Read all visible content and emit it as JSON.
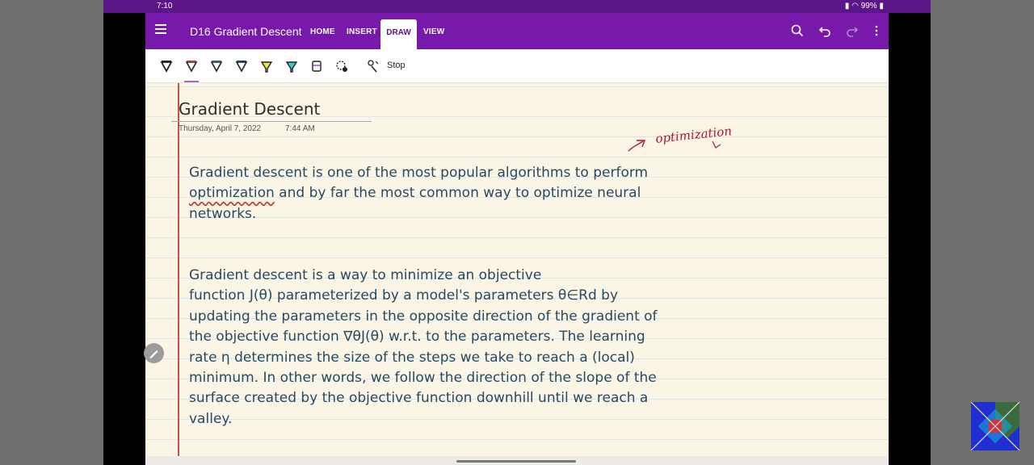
{
  "status": {
    "time": "7:10",
    "battery": "99%"
  },
  "appbar": {
    "page_name": "D16 Gradient Descent",
    "tabs": [
      "HOME",
      "INSERT",
      "DRAW",
      "VIEW"
    ],
    "active_tab": "DRAW"
  },
  "toolbar": {
    "stop_label": "Stop"
  },
  "note": {
    "title": "Gradient Descent",
    "date": "Thursday, April 7, 2022",
    "time": "7:44 AM",
    "handwriting": "optimization",
    "para1_line1": "Gradient descent is one of the most popular algorithms to perform",
    "para1_underlined": "optimization",
    "para1_line2_rest": " and by far the most common way to optimize neural",
    "para1_line3": "networks.",
    "para2": [
      "Gradient descent is a way to minimize an objective",
      "function J(θ) parameterized by a model's parameters θ∈Rd by",
      "updating the parameters in the opposite direction of the gradient of",
      "the objective function ∇θJ(θ) w.r.t. to the parameters. The learning",
      "rate η determines the size of the steps we take to reach a (local)",
      "minimum. In other words, we follow the direction of the slope of the",
      "surface created by the objective function downhill until we reach a",
      "valley."
    ]
  },
  "colors": {
    "appbar": "#7719aa",
    "text": "#264a63",
    "margin": "#c8504a",
    "ink": "#b0152a"
  }
}
